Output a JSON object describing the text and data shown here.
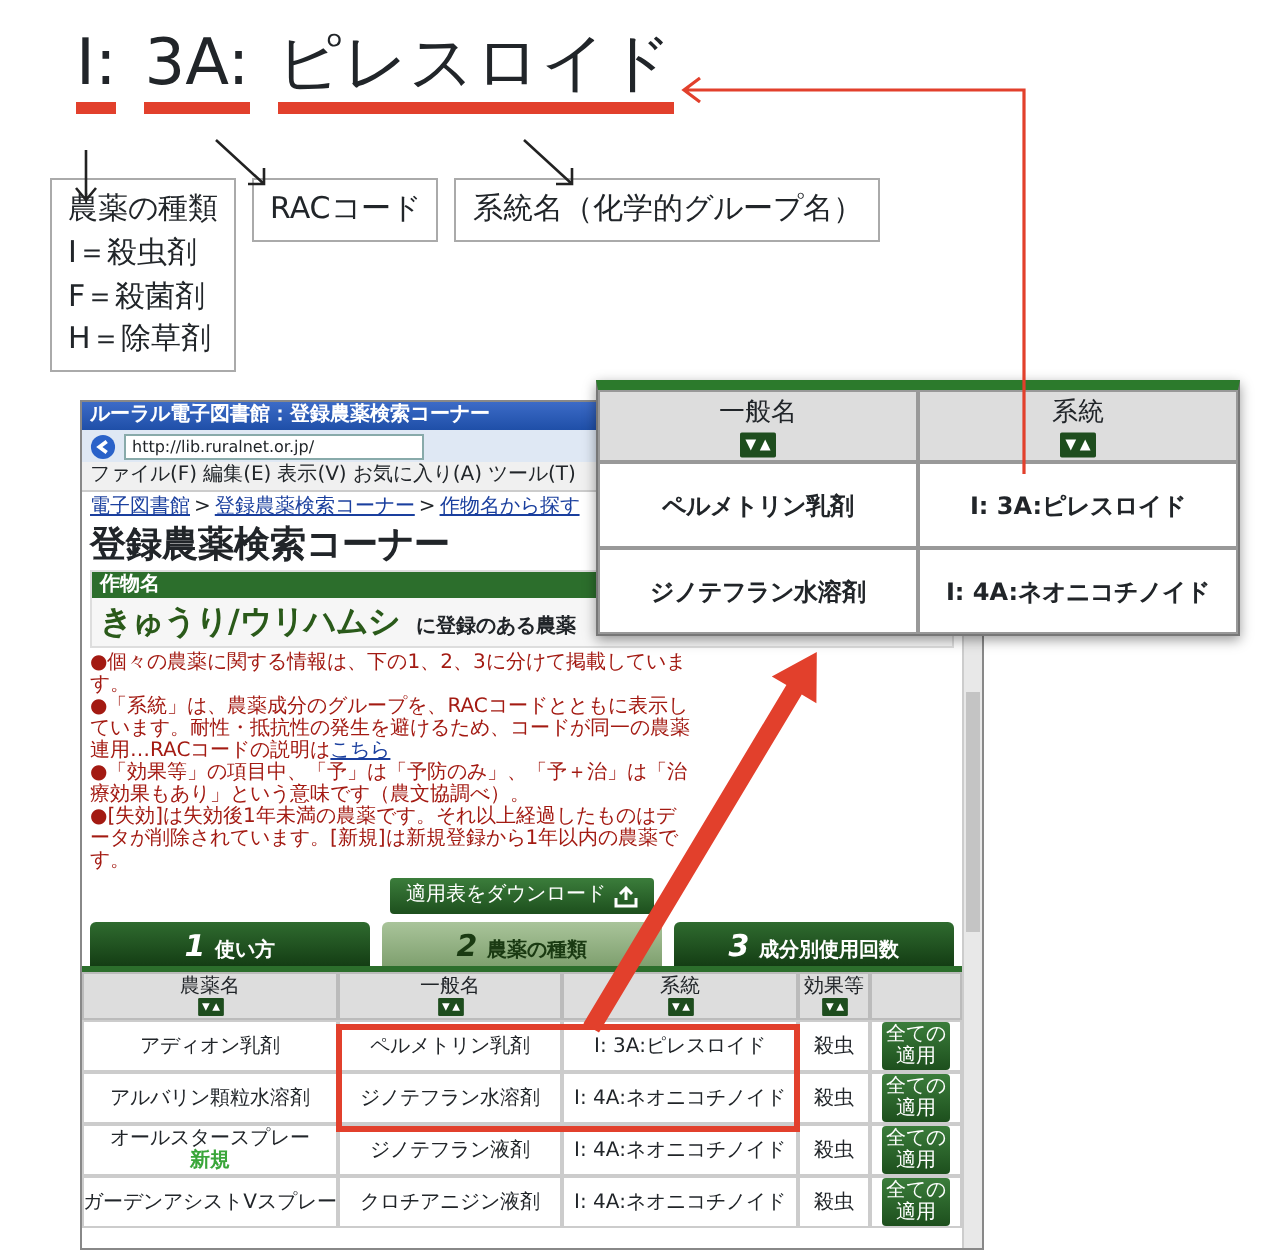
{
  "annotation": {
    "code_parts": [
      "I:",
      "3A:",
      "ピレスロイド"
    ],
    "boxes": [
      {
        "title": "農薬の種類",
        "lines": [
          "I＝殺虫剤",
          "F＝殺菌剤",
          "H＝除草剤"
        ]
      },
      {
        "title": "RACコード"
      },
      {
        "title": "系統名（化学的グループ名）"
      }
    ]
  },
  "browser": {
    "title": "ルーラル電子図書館：登録農薬検索コーナー",
    "address": "http://lib.ruralnet.or.jp/",
    "menu": [
      "ファイル(F)",
      "編集(E)",
      "表示(V)",
      "お気に入り(A)",
      "ツール(T)"
    ],
    "breadcrumb": [
      {
        "kind": "link",
        "text": "電子図書館"
      },
      {
        "kind": "sep",
        "text": ">"
      },
      {
        "kind": "link",
        "text": "登録農薬検索コーナー"
      },
      {
        "kind": "sep",
        "text": ">"
      },
      {
        "kind": "link",
        "text": "作物名から探す"
      }
    ],
    "heading": "登録農薬検索コーナー",
    "crop_label": "作物名",
    "crop": "きゅうり/ウリハムシ",
    "crop_suffix": "に登録のある農薬",
    "notes": [
      {
        "text": "●個々の農薬に関する情報は、下の1、2、3に分けて掲載しています。"
      },
      {
        "text": "●「系統」は、農薬成分のグループを、RACコードとともに表示しています。耐性・抵抗性の発生を避けるため、コードが同一の農薬連用…RACコードの説明は",
        "link": "こちら"
      },
      {
        "text": "●「効果等」の項目中、「予」は「予防のみ」、「予＋治」は「治療効果もあり」という意味です（農文協調べ）。"
      },
      {
        "text": "●[失効]は失効後1年未満の農薬です。それ以上経過したものはデータが削除されています。[新規]は新規登録から1年以内の農薬です。"
      }
    ],
    "download_button": "適用表をダウンロード",
    "tabs": [
      {
        "number": "1",
        "label": "使い方",
        "selected": false
      },
      {
        "number": "2",
        "label": "農薬の種類",
        "selected": true
      },
      {
        "number": "3",
        "label": "成分別使用回数",
        "selected": false
      }
    ],
    "table": {
      "columns": [
        "農薬名",
        "一般名",
        "系統",
        "効果等"
      ],
      "rows": [
        {
          "name": "アディオン乳剤",
          "generic": "ペルメトリン乳剤",
          "group": "I: 3A:ピレスロイド",
          "effect": "殺虫",
          "button": "全ての適用",
          "highlighted": true
        },
        {
          "name": "アルバリン顆粒水溶剤",
          "generic": "ジノテフラン水溶剤",
          "group": "I: 4A:ネオニコチノイド",
          "effect": "殺虫",
          "button": "全ての適用",
          "highlighted": true
        },
        {
          "name": "オールスタースプレー",
          "badge": "新規",
          "generic": "ジノテフラン液剤",
          "group": "I: 4A:ネオニコチノイド",
          "effect": "殺虫",
          "button": "全ての適用",
          "highlighted": false
        },
        {
          "name": "ガーデンアシストVスプレー",
          "generic": "クロチアニジン液剤",
          "group": "I: 4A:ネオニコチノイド",
          "effect": "殺虫",
          "button": "全ての適用",
          "highlighted": false
        }
      ]
    }
  },
  "popup": {
    "columns": [
      "一般名",
      "系統"
    ],
    "rows": [
      [
        "ペルメトリン乳剤",
        "I: 3A:ピレスロイド"
      ],
      [
        "ジノテフラン水溶剤",
        "I: 4A:ネオニコチノイド"
      ]
    ]
  }
}
